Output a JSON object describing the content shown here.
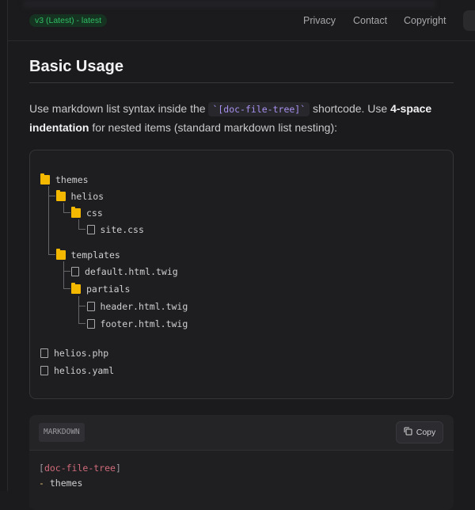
{
  "header": {
    "version_badge": "v3 (Latest)  - latest",
    "nav": [
      "Privacy",
      "Contact",
      "Copyright"
    ]
  },
  "section": {
    "title": "Basic Usage",
    "para": {
      "t1": "Use markdown list syntax inside the ",
      "code": "`[doc-file-tree]`",
      "t2": " shortcode. Use ",
      "bold": "4-space indentation",
      "t3": " for nested items (standard markdown list nesting):"
    }
  },
  "tree": [
    {
      "name": "themes",
      "type": "folder"
    },
    {
      "name": "helios",
      "type": "folder"
    },
    {
      "name": "css",
      "type": "folder"
    },
    {
      "name": "site.css",
      "type": "file"
    },
    {
      "name": "templates",
      "type": "folder"
    },
    {
      "name": "default.html.twig",
      "type": "file"
    },
    {
      "name": "partials",
      "type": "folder"
    },
    {
      "name": "header.html.twig",
      "type": "file"
    },
    {
      "name": "footer.html.twig",
      "type": "file"
    },
    {
      "name": "helios.php",
      "type": "file"
    },
    {
      "name": "helios.yaml",
      "type": "file"
    }
  ],
  "codeblock": {
    "lang": "MARKDOWN",
    "copy": "Copy",
    "line1_open": "[",
    "line1_tag": "doc-file-tree",
    "line1_close": "]",
    "line2_dash": "-",
    "line2_text": " themes"
  }
}
